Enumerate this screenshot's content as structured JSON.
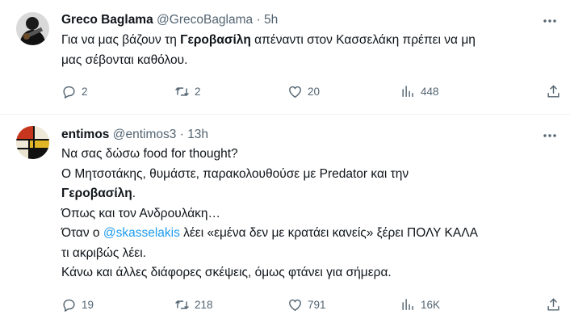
{
  "tweets": [
    {
      "name": "Greco Baglama",
      "handle": "@GrecoBaglama",
      "dot": "·",
      "time": "5h",
      "body_lines": [
        [
          "Για να μας βάζουν τη ",
          "Γεροβασίλη",
          " απέναντι στον Κασσελάκη πρέπει να μη"
        ],
        [
          "μας σέβονται καθόλου."
        ]
      ],
      "stats": {
        "replies": "2",
        "retweets": "2",
        "likes": "20",
        "views": "448"
      }
    },
    {
      "name": "entimos",
      "handle": "@entimos3",
      "dot": "·",
      "time": "13h",
      "body_lines": [
        "Να σας δώσω food for thought?",
        "Ο Μητσοτάκης, θυμάστε, παρακολουθούσε με Predator και την",
        "Γεροβασίλη",
        ".",
        "Όπως και τον Ανδρουλάκη…",
        "Όταν ο ",
        "@skasselakis",
        " λέει «εμένα δεν με κρατάει κανείς» ξέρει ΠΟΛΥ ΚΑΛΑ",
        "τι ακριβώς λέει.",
        "Κάνω και άλλες διάφορες σκέψεις, όμως φτάνει για σήμερα."
      ],
      "stats": {
        "replies": "19",
        "retweets": "218",
        "likes": "791",
        "views": "16K"
      }
    }
  ],
  "colors": {
    "text": "#0f1419",
    "secondary": "#536471",
    "link": "#1d9bf0",
    "divider": "#eff3f4"
  },
  "icons": [
    "avatar-photo",
    "more-icon",
    "reply-icon",
    "retweet-icon",
    "like-icon",
    "views-icon",
    "share-icon"
  ]
}
